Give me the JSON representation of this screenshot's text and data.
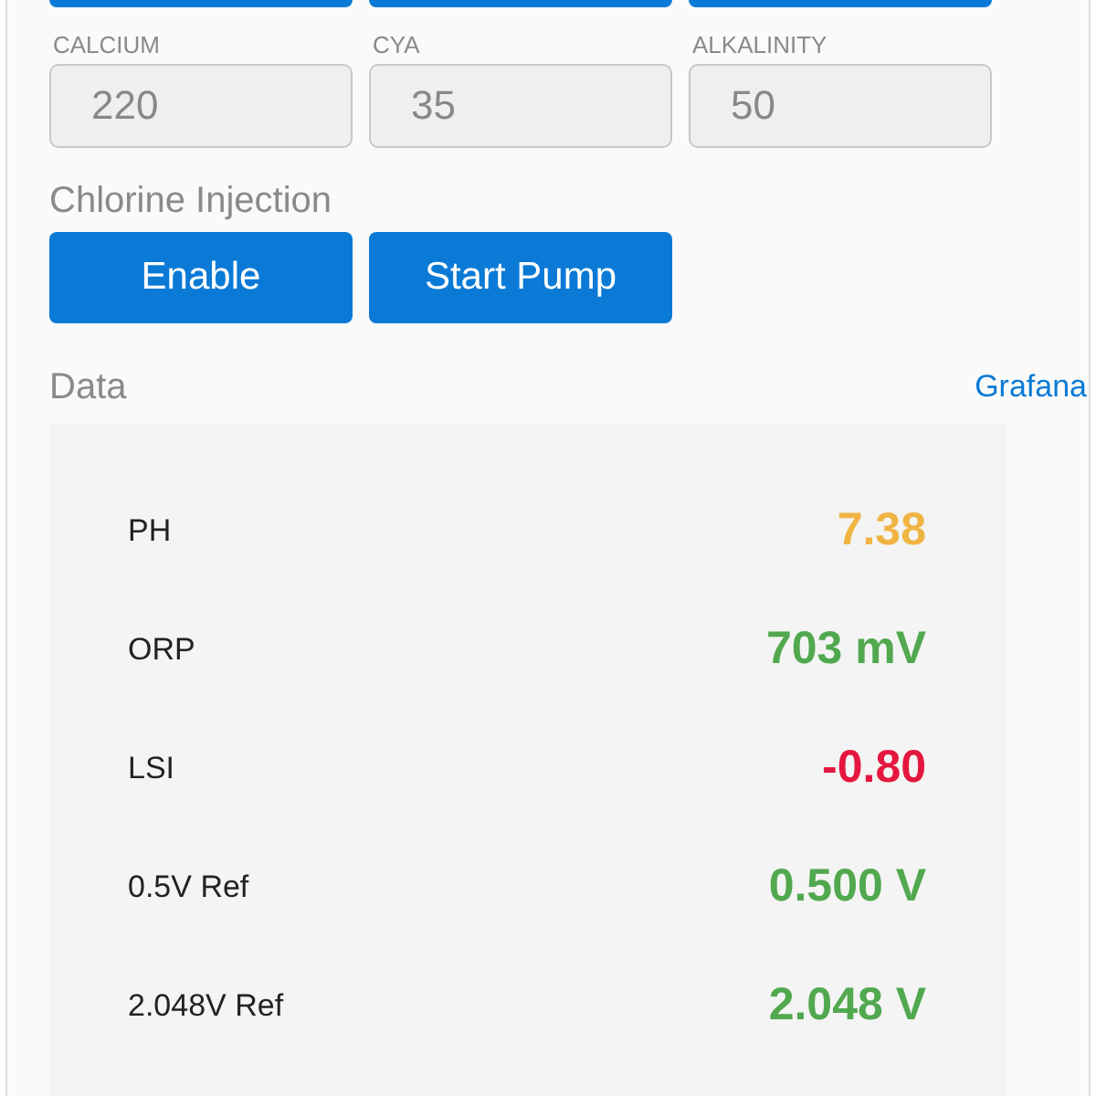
{
  "top_buttons": [
    {
      "kind": "button"
    },
    {
      "kind": "button"
    },
    {
      "kind": "button"
    }
  ],
  "fields": [
    {
      "label": "CALCIUM",
      "value": "220",
      "disabled": true
    },
    {
      "label": "CYA",
      "value": "35",
      "disabled": true
    },
    {
      "label": "ALKALINITY",
      "value": "50",
      "disabled": true
    }
  ],
  "chlorine_injection": {
    "title": "Chlorine Injection",
    "buttons": [
      "Enable",
      "Start Pump"
    ]
  },
  "data": {
    "title": "Data",
    "link": "Grafana",
    "readings": [
      {
        "name": "PH",
        "value": "7.38",
        "color": "#f0b443"
      },
      {
        "name": "ORP",
        "value": "703 mV",
        "color": "#51a84f"
      },
      {
        "name": "LSI",
        "value": "-0.80",
        "color": "#e5173f"
      },
      {
        "name": "0.5V Ref",
        "value": "0.500 V",
        "color": "#51a84f"
      },
      {
        "name": "2.048V Ref",
        "value": "2.048 V",
        "color": "#51a84f"
      }
    ]
  }
}
